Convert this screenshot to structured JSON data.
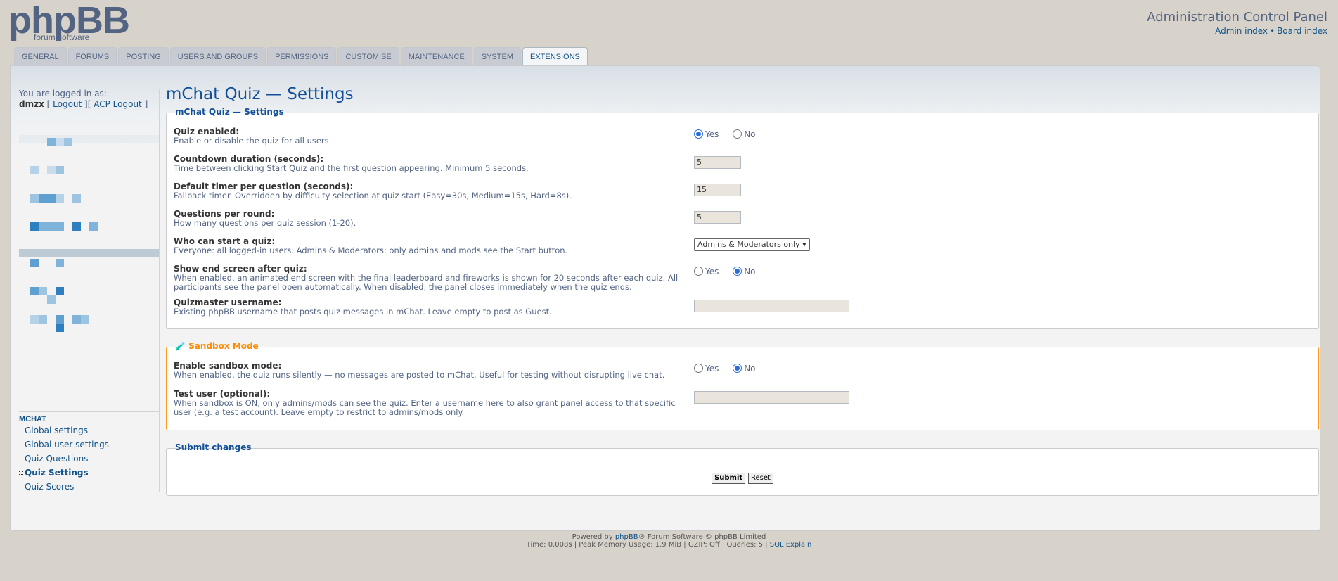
{
  "header": {
    "logo_text": "phpBB",
    "logo_sub": "forum software",
    "title": "Administration Control Panel",
    "admin_index": "Admin index",
    "board_index": "Board index",
    "separator": "•"
  },
  "tabs": [
    {
      "label": "GENERAL",
      "active": false
    },
    {
      "label": "FORUMS",
      "active": false
    },
    {
      "label": "POSTING",
      "active": false
    },
    {
      "label": "USERS AND GROUPS",
      "active": false
    },
    {
      "label": "PERMISSIONS",
      "active": false
    },
    {
      "label": "CUSTOMISE",
      "active": false
    },
    {
      "label": "MAINTENANCE",
      "active": false
    },
    {
      "label": "SYSTEM",
      "active": false
    },
    {
      "label": "EXTENSIONS",
      "active": true
    }
  ],
  "sidebar": {
    "logged_in_as": "You are logged in as:",
    "username": "dmzx",
    "logout": "Logout",
    "acp_logout": "ACP Logout",
    "menu_head": "MCHAT",
    "items": [
      {
        "label": "Global settings",
        "active": false
      },
      {
        "label": "Global user settings",
        "active": false
      },
      {
        "label": "Quiz Questions",
        "active": false
      },
      {
        "label": "Quiz Settings",
        "active": true
      },
      {
        "label": "Quiz Scores",
        "active": false
      }
    ]
  },
  "main": {
    "title": "mChat Quiz — Settings",
    "settings_legend": "mChat Quiz — Settings",
    "settings": {
      "quiz_enabled": {
        "label": "Quiz enabled:",
        "explain": "Enable or disable the quiz for all users.",
        "value": "Yes"
      },
      "countdown": {
        "label": "Countdown duration (seconds):",
        "explain": "Time between clicking Start Quiz and the first question appearing. Minimum 5 seconds.",
        "value": "5"
      },
      "timer": {
        "label": "Default timer per question (seconds):",
        "explain": "Fallback timer. Overridden by difficulty selection at quiz start (Easy=30s, Medium=15s, Hard=8s).",
        "value": "15"
      },
      "questions": {
        "label": "Questions per round:",
        "explain": "How many questions per quiz session (1-20).",
        "value": "5"
      },
      "who": {
        "label": "Who can start a quiz:",
        "explain": "Everyone: all logged-in users. Admins & Moderators: only admins and mods see the Start button.",
        "value": "Admins & Moderators only"
      },
      "end_screen": {
        "label": "Show end screen after quiz:",
        "explain": "When enabled, an animated end screen with the final leaderboard and fireworks is shown for 20 seconds after each quiz. All participants see the panel open automatically. When disabled, the panel closes immediately when the quiz ends.",
        "value": "No"
      },
      "quizmaster": {
        "label": "Quizmaster username:",
        "explain": "Existing phpBB username that posts quiz messages in mChat. Leave empty to post as Guest.",
        "value": ""
      }
    },
    "sandbox_legend": "Sandbox Mode",
    "sandbox_icon": "test-tube-icon",
    "sandbox": {
      "enable": {
        "label": "Enable sandbox mode:",
        "explain": "When enabled, the quiz runs silently — no messages are posted to mChat. Useful for testing without disrupting live chat.",
        "value": "No"
      },
      "test_user": {
        "label": "Test user (optional):",
        "explain": "When sandbox is ON, only admins/mods can see the quiz. Enter a username here to also grant panel access to that specific user (e.g. a test account). Leave empty to restrict to admins/mods only.",
        "value": ""
      }
    },
    "radio_yes": "Yes",
    "radio_no": "No",
    "submit_legend": "Submit changes",
    "submit": "Submit",
    "reset": "Reset"
  },
  "footer": {
    "powered_pre": "Powered by ",
    "powered_link": "phpBB",
    "powered_post": "® Forum Software © phpBB Limited",
    "stats": "Time: 0.008s | Peak Memory Usage: 1.9 MiB | GZIP: Off | Queries: 5 | ",
    "sql_explain": "SQL Explain"
  }
}
